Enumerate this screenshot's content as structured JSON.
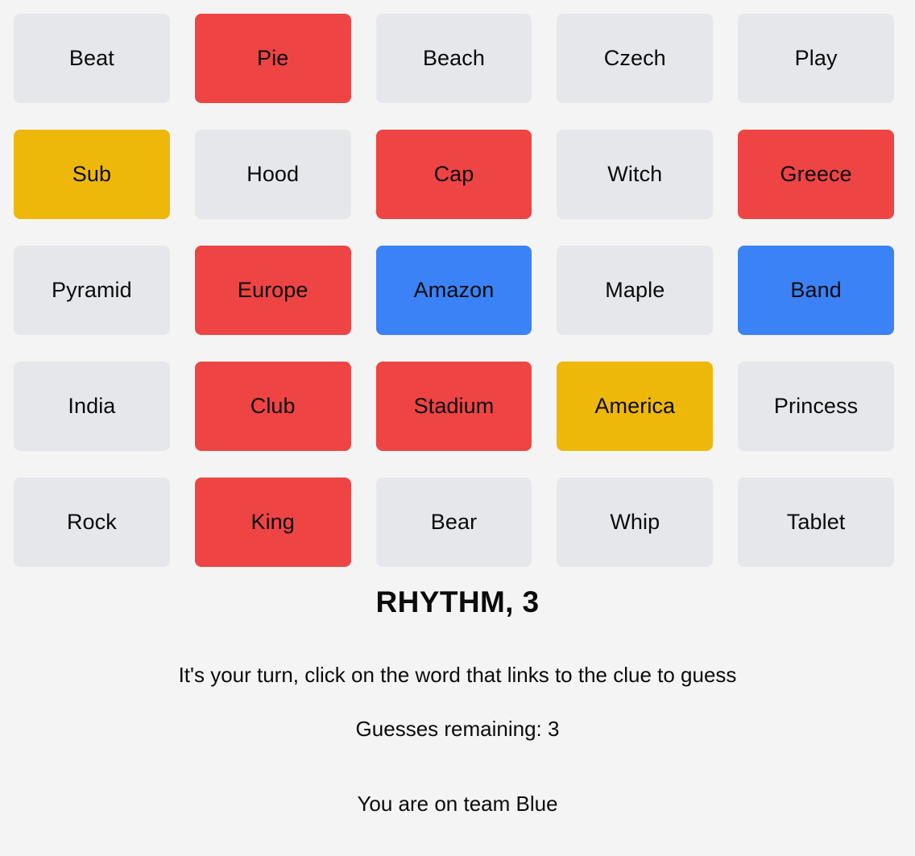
{
  "board": {
    "columns": 5,
    "rows": 5,
    "cards": [
      {
        "word": "Beat",
        "state": "neutral",
        "revealed": false
      },
      {
        "word": "Pie",
        "state": "red",
        "revealed": true
      },
      {
        "word": "Beach",
        "state": "neutral",
        "revealed": false
      },
      {
        "word": "Czech",
        "state": "neutral",
        "revealed": false
      },
      {
        "word": "Play",
        "state": "neutral",
        "revealed": false
      },
      {
        "word": "Sub",
        "state": "yellow",
        "revealed": true
      },
      {
        "word": "Hood",
        "state": "neutral",
        "revealed": false
      },
      {
        "word": "Cap",
        "state": "red",
        "revealed": true
      },
      {
        "word": "Witch",
        "state": "neutral",
        "revealed": false
      },
      {
        "word": "Greece",
        "state": "red",
        "revealed": true
      },
      {
        "word": "Pyramid",
        "state": "neutral",
        "revealed": false
      },
      {
        "word": "Europe",
        "state": "red",
        "revealed": true
      },
      {
        "word": "Amazon",
        "state": "blue",
        "revealed": true
      },
      {
        "word": "Maple",
        "state": "neutral",
        "revealed": false
      },
      {
        "word": "Band",
        "state": "blue",
        "revealed": true
      },
      {
        "word": "India",
        "state": "neutral",
        "revealed": false
      },
      {
        "word": "Club",
        "state": "red",
        "revealed": true
      },
      {
        "word": "Stadium",
        "state": "red",
        "revealed": true
      },
      {
        "word": "America",
        "state": "yellow",
        "revealed": true
      },
      {
        "word": "Princess",
        "state": "neutral",
        "revealed": false
      },
      {
        "word": "Rock",
        "state": "neutral",
        "revealed": false
      },
      {
        "word": "King",
        "state": "red",
        "revealed": true
      },
      {
        "word": "Bear",
        "state": "neutral",
        "revealed": false
      },
      {
        "word": "Whip",
        "state": "neutral",
        "revealed": false
      },
      {
        "word": "Tablet",
        "state": "neutral",
        "revealed": false
      }
    ]
  },
  "clue": {
    "word": "RHYTHM",
    "number": 3,
    "display": "RHYTHM, 3"
  },
  "status": {
    "turn_message": "It's your turn, click on the word that links to the clue to guess",
    "guesses_remaining_label": "Guesses remaining: 3",
    "guesses_remaining": 3,
    "team_message": "You are on team Blue",
    "player_team": "Blue"
  },
  "colors": {
    "background": "#f4f4f4",
    "card_neutral": "#e5e7eb",
    "card_red": "#ef4444",
    "card_blue": "#3b82f6",
    "card_yellow": "#eeb80a",
    "text": "#0b0b0b"
  }
}
